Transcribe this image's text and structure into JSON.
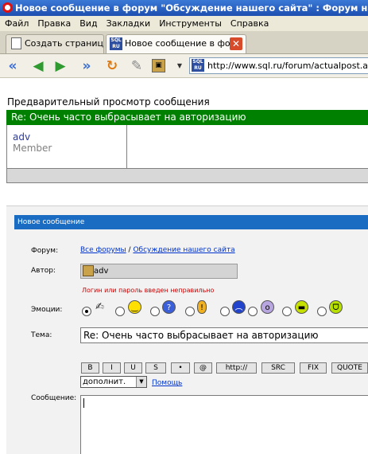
{
  "window": {
    "title": "Новое сообщение в форум \"Обсуждение нашего сайта\" : Форум на SQL.RU - Opera"
  },
  "menu": [
    "Файл",
    "Правка",
    "Вид",
    "Закладки",
    "Инструменты",
    "Справка"
  ],
  "tabs": [
    {
      "label": "Создать страницу",
      "active": false
    },
    {
      "label": "Новое сообщение в фо...",
      "active": true
    }
  ],
  "favicon_text": [
    "SQL",
    "RU"
  ],
  "nav": {
    "icons": [
      "rewind-icon",
      "back-icon",
      "forward-icon",
      "fast-forward-icon",
      "reload-icon",
      "edit-icon",
      "panel-icon",
      "dropdown-icon"
    ],
    "address": "http://www.sql.ru/forum/actualpost.aspx"
  },
  "preview": {
    "title": "Предварительный просмотр сообщения",
    "subject": "Re: Очень часто выбрасывает на авторизацию",
    "author_name": "adv",
    "author_role": "Member"
  },
  "form": {
    "header": "Новое сообщение",
    "labels": {
      "forum": "Форум:",
      "author": "Автор:",
      "emotions": "Эмоции:",
      "subject": "Тема:",
      "message": "Сообщение:"
    },
    "forum_link_all": "Все форумы",
    "forum_sep": "/",
    "forum_link_current": "Обсуждение нашего сайта",
    "author_value": "adv",
    "error": "Логин или пароль введен неправильно",
    "emotions_selected": 0,
    "subject_value": "Re: Очень часто выбрасывает на авторизацию",
    "toolbar_buttons": [
      "B",
      "I",
      "U",
      "S",
      "•",
      "@",
      "http://",
      "SRC",
      "FIX",
      "QUOTE"
    ],
    "select_value": "дополнит.",
    "help": "Помощь",
    "message_value": ""
  },
  "colors": {
    "title_bar": "#1d4fb0",
    "preview_header": "#008000",
    "form_header": "#1a6bc2",
    "error": "#cc0000",
    "link": "#0033cc"
  }
}
